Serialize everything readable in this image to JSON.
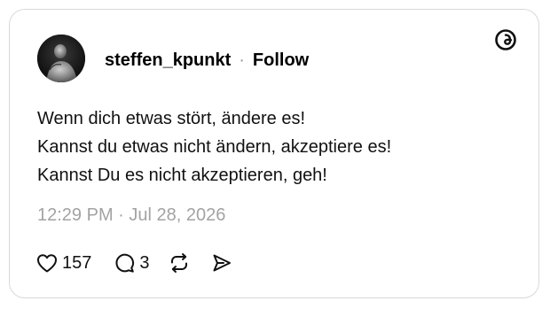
{
  "post": {
    "author": {
      "username": "steffen_kpunkt",
      "follow_label": "Follow",
      "separator": "·"
    },
    "text_lines": [
      "Wenn dich etwas stört, ändere es!",
      "Kannst du etwas nicht ändern, akzeptiere es!",
      "Kannst Du es nicht akzeptieren, geh!"
    ],
    "timestamp": "12:29 PM · Jul 28, 2026",
    "stats": {
      "likes": "157",
      "replies": "3"
    }
  },
  "icons": {
    "brand": "threads-logo-icon",
    "like": "heart-icon",
    "reply": "speech-bubble-icon",
    "repost": "repost-arrows-icon",
    "share": "send-icon"
  },
  "colors": {
    "text": "#111111",
    "muted": "#a3a3a3",
    "border": "#d9d9d9"
  }
}
